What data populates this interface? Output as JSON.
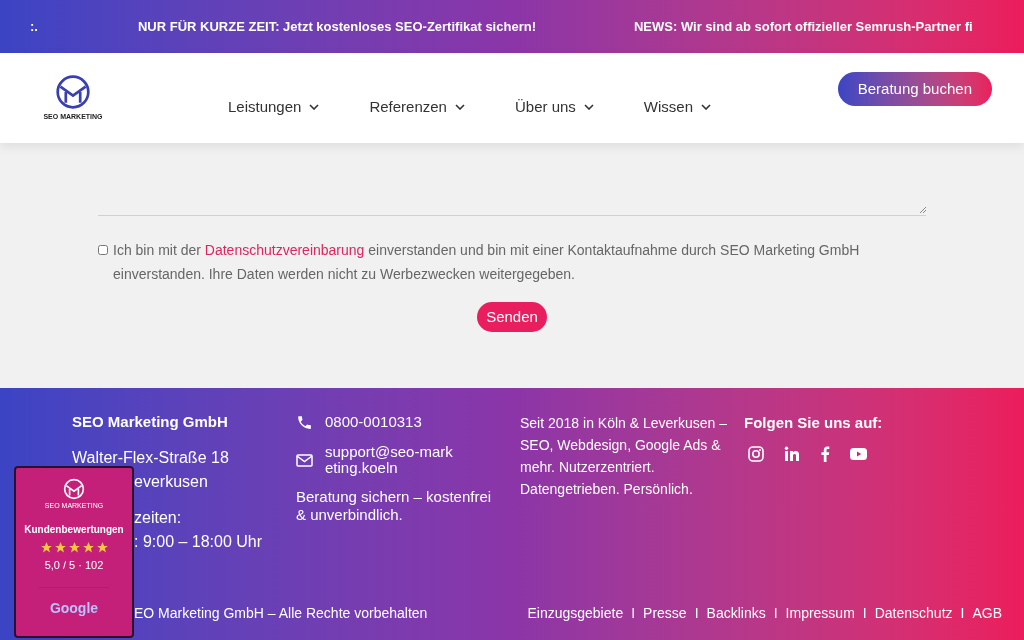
{
  "ticker": {
    "items": [
      ":.",
      "NUR FÜR KURZE ZEIT: Jetzt kostenloses SEO-Zertifikat sichern!",
      "NEWS: Wir sind ab sofort offizieller Semrush-Partner fi"
    ]
  },
  "header": {
    "logo_text": "SEO MARKETING",
    "nav": [
      {
        "label": "Leistungen"
      },
      {
        "label": "Referenzen"
      },
      {
        "label": "Über uns"
      },
      {
        "label": "Wissen"
      }
    ],
    "cta": "Beratung buchen"
  },
  "form": {
    "consent": {
      "checked": false,
      "before": "Ich bin mit der",
      "link": "Datenschutzvereinbarung",
      "after": "einverstanden und bin mit einer Kontaktaufnahme durch SEO Marketing GmbH einverstanden. Ihre Daten werden nicht zu Werbezwecken weitergegeben."
    },
    "submit": "Senden"
  },
  "footer": {
    "company": "SEO Marketing GmbH",
    "address": [
      "Walter-Flex-Straße 18",
      "everkusen"
    ],
    "hours": [
      "zeiten:",
      ": 9:00 – 18:00 Uhr"
    ],
    "phone": "0800-0010313",
    "email": "support@seo-marketing.koeln",
    "note": "Beratung sichern – kostenfrei & unverbindlich.",
    "about": "Seit 2018 in Köln & Leverkusen – SEO, Webdesign, Google Ads & mehr. Nutzerzentriert. Datengetrieben. Persönlich.",
    "follow": "Folgen Sie uns auf:",
    "social": [
      {
        "kind": "instagram"
      },
      {
        "kind": "linkedin"
      },
      {
        "kind": "facebook"
      },
      {
        "kind": "youtube"
      }
    ],
    "copyright": "EO Marketing GmbH – Alle Rechte vorbehalten",
    "links": [
      "Einzugsgebiete",
      "Presse",
      "Backlinks",
      "Impressum",
      "Datenschutz",
      "AGB"
    ],
    "separators": [
      "I",
      "I",
      "I",
      "I",
      "I"
    ]
  },
  "reviews": {
    "logo_text": "SEO MARKETING",
    "title": "Kundenbewertungen",
    "stars": 5,
    "score": "5,0 / 5 · 102",
    "brand": "Google"
  }
}
